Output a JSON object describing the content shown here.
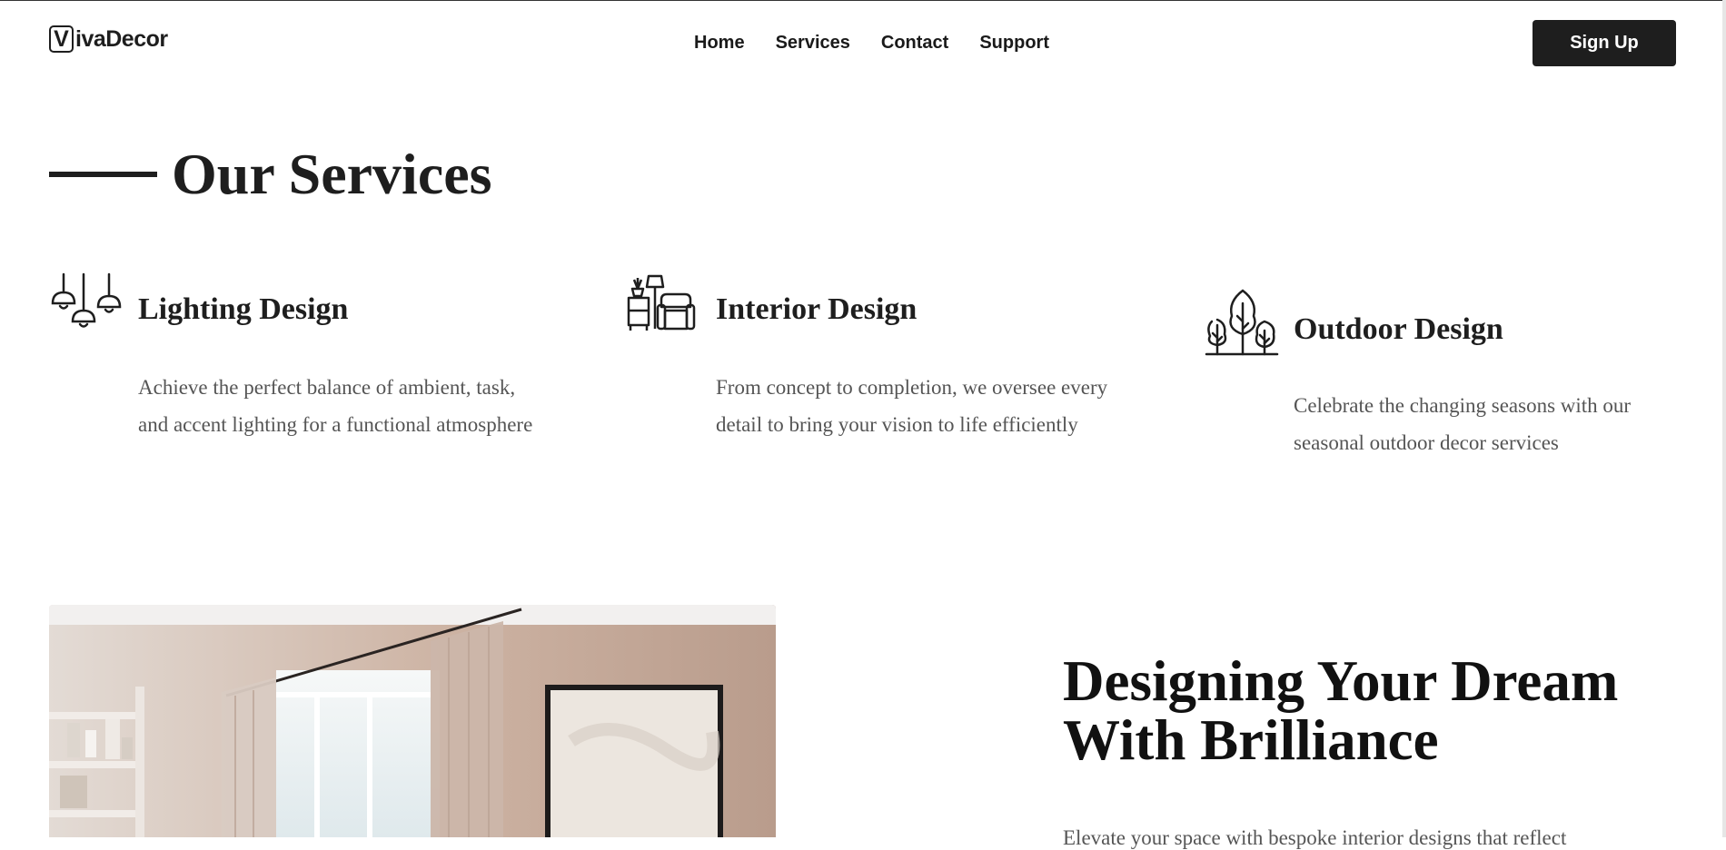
{
  "header": {
    "logo": {
      "first_letter": "V",
      "rest": "ivaDecor"
    },
    "nav": [
      "Home",
      "Services",
      "Contact",
      "Support"
    ],
    "signup_label": "Sign Up"
  },
  "services": {
    "title": "Our Services",
    "items": [
      {
        "icon": "pendant-lamps-icon",
        "title": "Lighting Design",
        "description": "Achieve the perfect balance of ambient, task, and accent lighting for a functional atmosphere"
      },
      {
        "icon": "armchair-lamp-icon",
        "title": "Interior Design",
        "description": "From concept to completion, we oversee every detail to bring your vision to life efficiently"
      },
      {
        "icon": "trees-icon",
        "title": "Outdoor Design",
        "description": "Celebrate the changing seasons with our seasonal outdoor decor services"
      }
    ]
  },
  "feature": {
    "title": "Designing Your Dream With Brilliance",
    "text": "Elevate your space with bespoke interior designs that reflect"
  },
  "colors": {
    "primary": "#1e1e1e",
    "body_text": "#555555",
    "background": "#ffffff"
  }
}
